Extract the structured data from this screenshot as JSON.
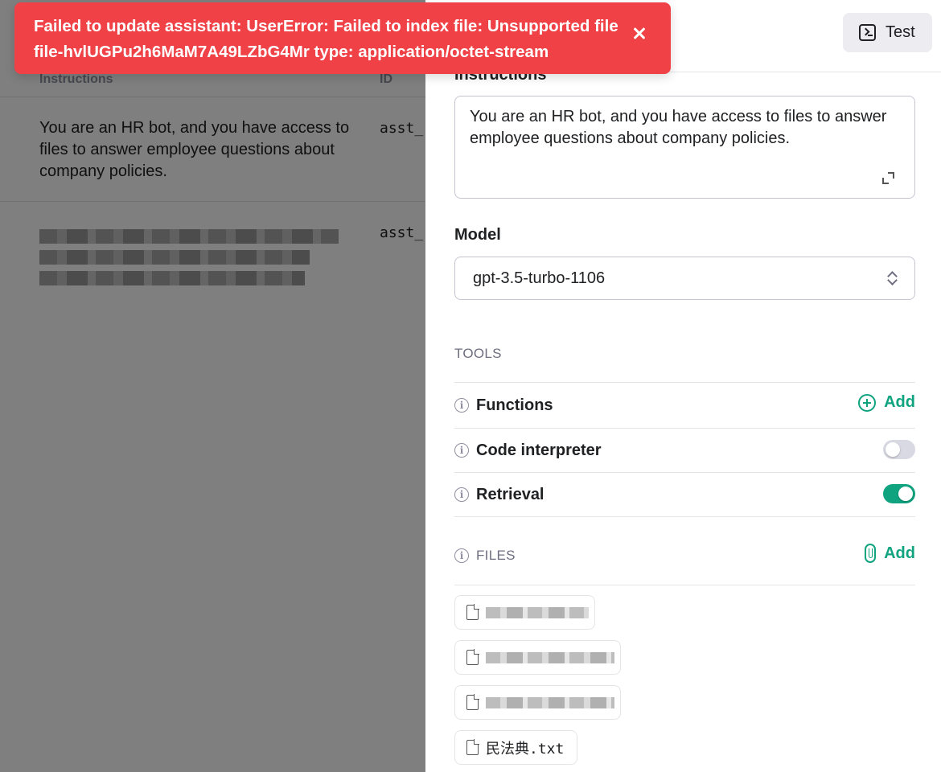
{
  "toast": {
    "message": "Failed to update assistant: UserError: Failed to index file: Unsupported file file-hvlUGPu2h6MaM7A49LZbG4Mr type: application/octet-stream",
    "close_icon": "close-icon"
  },
  "list": {
    "columns": {
      "instructions": "Instructions",
      "id": "ID"
    },
    "rows": [
      {
        "instructions": "You are an HR bot, and you have access to files to answer employee questions about company policies.",
        "id": "asst_"
      },
      {
        "instructions": "",
        "id": "asst_"
      }
    ]
  },
  "header": {
    "test_label": "Test",
    "test_icon": "terminal-icon"
  },
  "instructions": {
    "label": "Instructions",
    "value": "You are an HR bot, and you have access to files to answer employee questions about company policies."
  },
  "model": {
    "label": "Model",
    "selected": "gpt-3.5-turbo-1106"
  },
  "tools": {
    "caption": "TOOLS",
    "functions": {
      "label": "Functions",
      "add_label": "Add"
    },
    "code_interpreter": {
      "label": "Code interpreter",
      "enabled": false
    },
    "retrieval": {
      "label": "Retrieval",
      "enabled": true
    }
  },
  "files": {
    "caption": "FILES",
    "add_label": "Add",
    "items": [
      {
        "name": ""
      },
      {
        "name": ""
      },
      {
        "name": ""
      },
      {
        "name": "民法典.txt"
      }
    ]
  },
  "colors": {
    "accent": "#10a37f",
    "error": "#ef4146",
    "toggle_off": "#d9d9e3"
  }
}
